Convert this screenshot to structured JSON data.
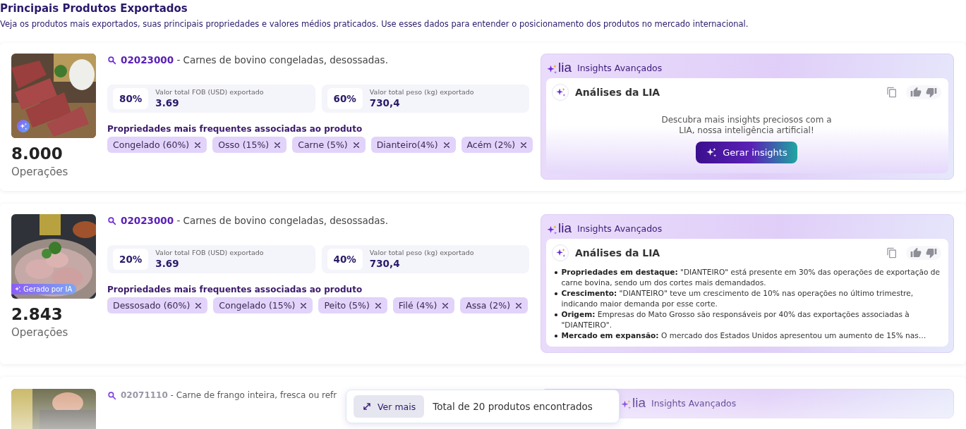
{
  "section": {
    "title": "Principais Produtos Exportados",
    "description": "Veja os produtos mais exportados, suas principais propriedades e valores médios praticados. Use esses dados para entender o posicionamento dos produtos no mercado internacional."
  },
  "products": [
    {
      "ai_badge": {
        "kind": "icon"
      },
      "code": "02023000",
      "description": " - Carnes de bovino congeladas, desossadas.",
      "count": "8.000",
      "count_label": "Operações",
      "metrics": [
        {
          "percent": "80%",
          "label": "Valor total FOB (USD) exportado",
          "value": "3.69"
        },
        {
          "percent": "60%",
          "label": "Valor total peso (kg) exportado",
          "value": "730,4"
        }
      ],
      "properties_title": "Propriedades mais frequentes associadas ao produto",
      "tags": [
        "Congelado (60%)",
        "Osso (15%)",
        "Carne (5%)",
        "Dianteiro(4%)",
        "Acém (2%)"
      ],
      "insights": {
        "brand": "lia",
        "header": "Insights Avançados",
        "title": "Análises da LIA",
        "kind": "prompt",
        "prompt": "Descubra mais insights preciosos com a LIA, nossa inteligência artificial!",
        "button": "Gerar insights"
      }
    },
    {
      "ai_badge": {
        "kind": "label",
        "label": "Gerado por IA"
      },
      "code": "02023000",
      "description": " - Carnes de bovino congeladas, desossadas.",
      "count": "2.843",
      "count_label": "Operações",
      "metrics": [
        {
          "percent": "20%",
          "label": "Valor total FOB (USD) exportado",
          "value": "3.69"
        },
        {
          "percent": "40%",
          "label": "Valor total peso (kg) exportado",
          "value": "730,4"
        }
      ],
      "properties_title": "Propriedades mais frequentes associadas ao produto",
      "tags": [
        "Dessosado (60%)",
        "Congelado (15%)",
        "Peito (5%)",
        "Filé (4%)",
        "Assa (2%)"
      ],
      "insights": {
        "brand": "lia",
        "header": "Insights Avançados",
        "title": "Análises da LIA",
        "kind": "list",
        "bullets": [
          "**Propriedades em destaque:** \"DIANTEIRO\" está presente em 30% das operações de exportação de carne bovina, sendo um dos cortes mais demandados.",
          "**Crescimento:** \"DIANTEIRO\" teve um crescimento de 10% nas operações no último trimestre, indicando maior demanda por esse corte.",
          "**Origem:** Empresas do Mato Grosso são responsáveis por 40% das exportações associadas à \"DIANTEIRO\".",
          "**Mercado em expansão:** O mercado dos Estados Unidos apresentou um aumento de 15% nas…"
        ]
      }
    },
    {
      "code": "02071110",
      "description": " - Carne de frango inteira, fresca ou refr",
      "insights": {
        "brand": "lia",
        "header": "Insights Avançados"
      }
    }
  ],
  "footer": {
    "button": "Ver mais",
    "summary": "Total de 20 produtos encontrados"
  }
}
